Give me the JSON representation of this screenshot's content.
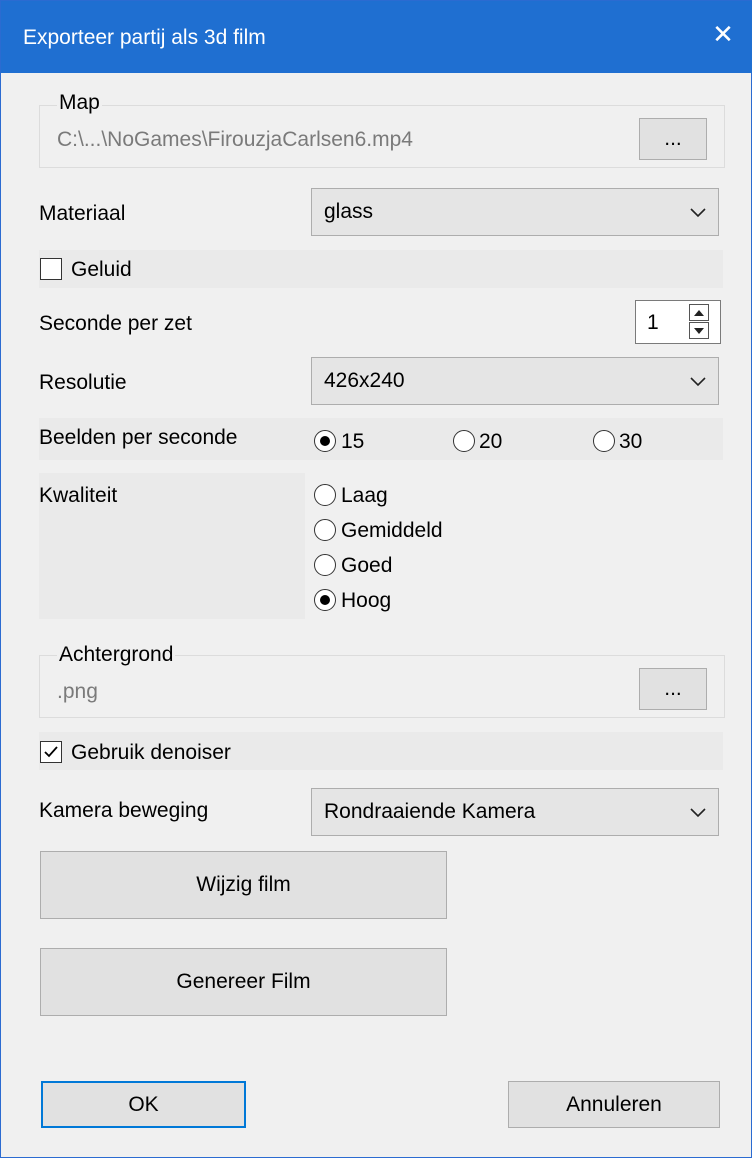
{
  "window": {
    "title": "Exporteer partij als 3d film",
    "close_glyph": "✕"
  },
  "map": {
    "group_label": "Map",
    "path": "C:\\...\\NoGames\\FirouzjaCarlsen6.mp4",
    "browse_label": "..."
  },
  "materiaal": {
    "label": "Materiaal",
    "value": "glass"
  },
  "geluid": {
    "label": "Geluid",
    "checked": false
  },
  "seconde": {
    "label": "Seconde per zet",
    "value": "1"
  },
  "resolutie": {
    "label": "Resolutie",
    "value": "426x240"
  },
  "fps": {
    "label": "Beelden per seconde",
    "options": [
      "15",
      "20",
      "30"
    ],
    "selected": "15"
  },
  "kwaliteit": {
    "label": "Kwaliteit",
    "options": [
      "Laag",
      "Gemiddeld",
      "Goed",
      "Hoog"
    ],
    "selected": "Hoog"
  },
  "achtergrond": {
    "group_label": "Achtergrond",
    "path": ".png",
    "browse_label": "..."
  },
  "denoiser": {
    "label": "Gebruik denoiser",
    "checked": true
  },
  "camera": {
    "label": "Kamera beweging",
    "value": "Rondraaiende Kamera"
  },
  "buttons": {
    "wijzig": "Wijzig film",
    "genereer": "Genereer Film",
    "ok": "OK",
    "annuleren": "Annuleren"
  },
  "colors": {
    "titlebar": "#1f6fd1",
    "dialog_bg": "#f0f0f0",
    "button_bg": "#e1e1e1",
    "focus_border": "#0078d7"
  }
}
